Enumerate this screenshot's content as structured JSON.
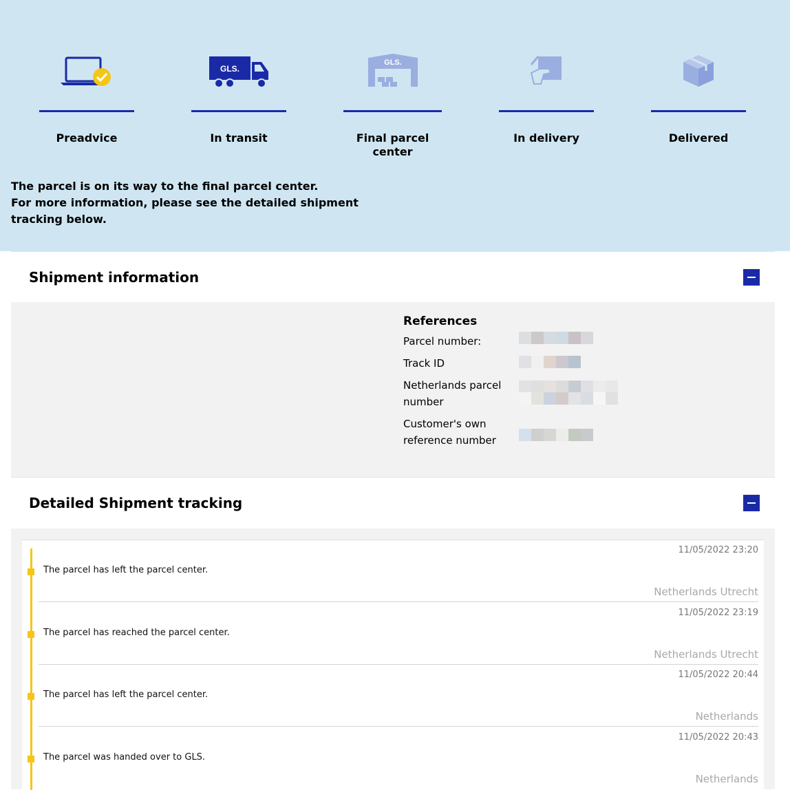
{
  "steps": [
    {
      "label": "Preadvice",
      "icon": "laptop-check-icon"
    },
    {
      "label": "In transit",
      "icon": "gls-truck-icon"
    },
    {
      "label": "Final parcel center",
      "icon": "gls-depot-icon"
    },
    {
      "label": "In delivery",
      "icon": "hand-parcel-icon"
    },
    {
      "label": "Delivered",
      "icon": "parcel-box-icon"
    }
  ],
  "status_message": {
    "line1": "The parcel is on its way to the final parcel center.",
    "line2": "For more information, please see the detailed shipment tracking below."
  },
  "shipment_info": {
    "title": "Shipment information",
    "references_title": "References",
    "labels": {
      "parcel_number": "Parcel number:",
      "track_id": "Track ID",
      "nl_parcel_number": "Netherlands parcel number",
      "customer_ref": "Customer's own reference number"
    }
  },
  "tracking": {
    "title": "Detailed Shipment tracking",
    "events": [
      {
        "date": "11/05/2022 23:20",
        "text": "The parcel has left the parcel center.",
        "location": "Netherlands Utrecht"
      },
      {
        "date": "11/05/2022 23:19",
        "text": "The parcel has reached the parcel center.",
        "location": "Netherlands Utrecht"
      },
      {
        "date": "11/05/2022 20:44",
        "text": "The parcel has left the parcel center.",
        "location": "Netherlands"
      },
      {
        "date": "11/05/2022 20:43",
        "text": "The parcel was handed over to GLS.",
        "location": "Netherlands"
      }
    ]
  },
  "colors": {
    "brand_blue": "#1a2aa7",
    "hero_bg": "#cfe6f2",
    "timeline_yellow": "#f5c518",
    "inactive_icon": "#9aaee0"
  }
}
